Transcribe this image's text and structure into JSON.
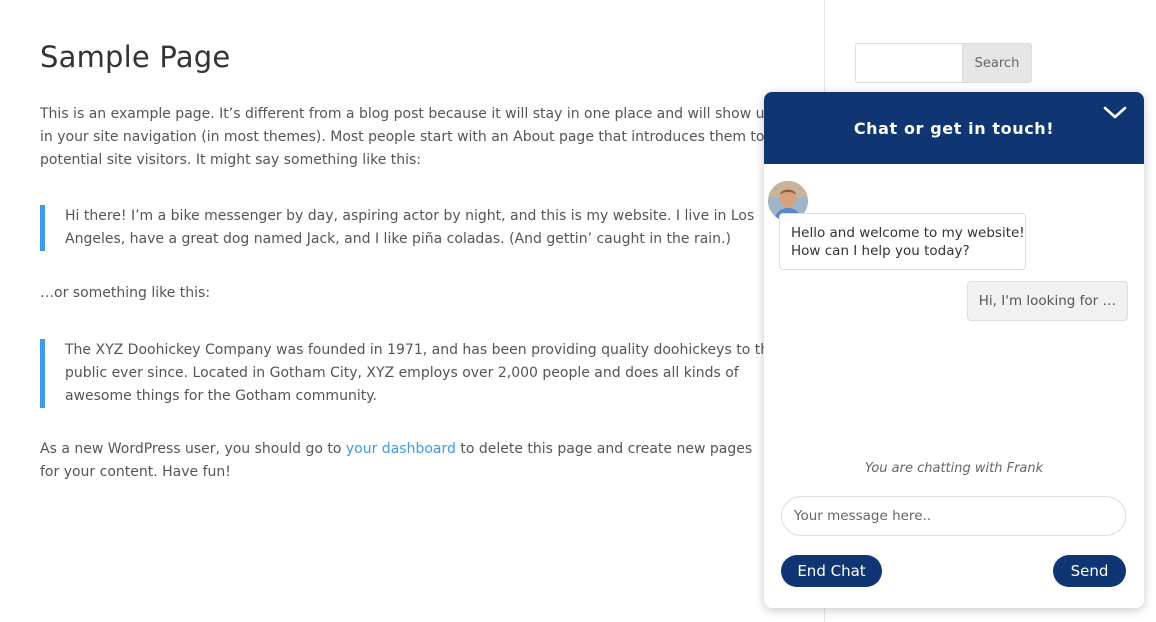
{
  "page": {
    "title": "Sample Page",
    "intro": "This is an example page. It’s different from a blog post because it will stay in one place and will show up in your site navigation (in most themes). Most people start with an About page that introduces them to potential site visitors. It might say something like this:",
    "quote1": "Hi there! I’m a bike messenger by day, aspiring actor by night, and this is my website. I live in Los Angeles, have a great dog named Jack, and I like piña coladas. (And gettin’ caught in the rain.)",
    "or_text": "…or something like this:",
    "quote2": "The XYZ Doohickey Company was founded in 1971, and has been providing quality doohickeys to the public ever since. Located in Gotham City, XYZ employs over 2,000 people and does all kinds of awesome things for the Gotham community.",
    "outro_before": "As a new WordPress user, you should go to ",
    "outro_link": "your dashboard",
    "outro_after": " to delete this page and create new pages for your content. Have fun!"
  },
  "sidebar": {
    "search_value": "",
    "search_button": "Search"
  },
  "chat": {
    "title": "Chat or get in touch!",
    "welcome_line1": "Hello and welcome to my website!",
    "welcome_line2": "How can I help you today?",
    "user_message": "Hi, I'm looking for …",
    "status": "You are chatting with Frank",
    "input_placeholder": "Your message here..",
    "end_button": "End Chat",
    "send_button": "Send"
  },
  "colors": {
    "accent": "#0f3572",
    "link": "#3d9be9",
    "quote_bar": "#3d9be9"
  },
  "icons": {
    "collapse": "chevron-down-icon",
    "avatar": "agent-avatar"
  }
}
